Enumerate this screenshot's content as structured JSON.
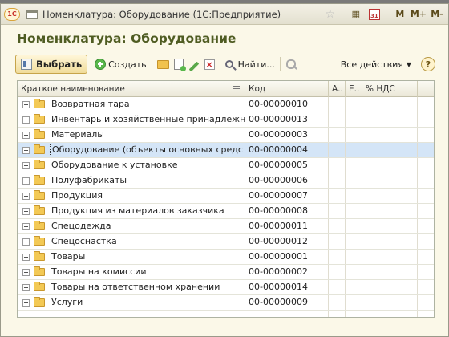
{
  "window": {
    "title": "Номенклатура: Оборудование  (1С:Предприятие)",
    "logo_text": "1С",
    "calendar_day": "31",
    "controls": {
      "m": "M",
      "m_plus": "M+",
      "m_minus": "M-"
    }
  },
  "form": {
    "heading": "Номенклатура: Оборудование"
  },
  "toolbar": {
    "select_label": "Выбрать",
    "create_label": "Создать",
    "find_label": "Найти...",
    "all_actions_label": "Все действия",
    "help_label": "?"
  },
  "table": {
    "columns": [
      "Краткое наименование",
      "Код",
      "А..",
      "Е..",
      "% НДС"
    ],
    "rows": [
      {
        "name": "Возвратная тара",
        "code": "00-00000010"
      },
      {
        "name": "Инвентарь и хозяйственные принадлежности",
        "code": "00-00000013"
      },
      {
        "name": "Материалы",
        "code": "00-00000003"
      },
      {
        "name": "Оборудование (объекты основных средств)",
        "code": "00-00000004",
        "selected": true
      },
      {
        "name": "Оборудование к установке",
        "code": "00-00000005"
      },
      {
        "name": "Полуфабрикаты",
        "code": "00-00000006"
      },
      {
        "name": "Продукция",
        "code": "00-00000007"
      },
      {
        "name": "Продукция из материалов заказчика",
        "code": "00-00000008"
      },
      {
        "name": "Спецодежда",
        "code": "00-00000011"
      },
      {
        "name": "Спецоснастка",
        "code": "00-00000012"
      },
      {
        "name": "Товары",
        "code": "00-00000001"
      },
      {
        "name": "Товары на комиссии",
        "code": "00-00000002"
      },
      {
        "name": "Товары на ответственном хранении",
        "code": "00-00000014"
      },
      {
        "name": "Услуги",
        "code": "00-00000009"
      }
    ]
  },
  "colors": {
    "heading": "#4f5c22",
    "selection": "#d4e5f7",
    "window_bg": "#fbf8e8"
  }
}
